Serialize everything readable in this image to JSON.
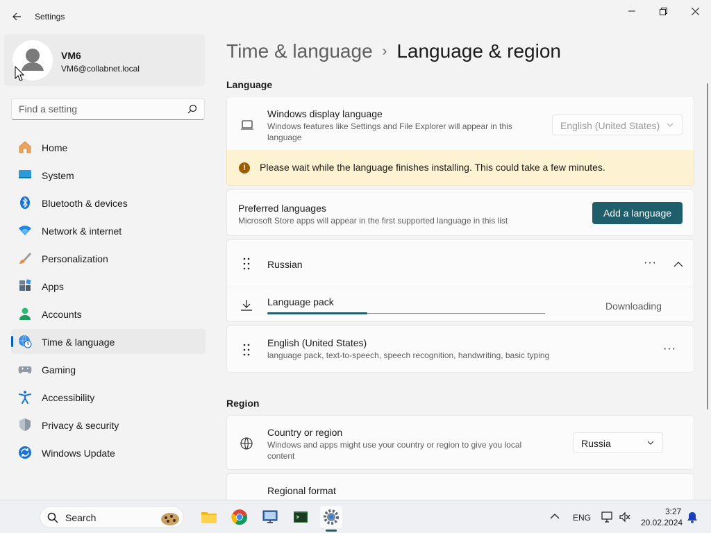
{
  "window": {
    "title": "Settings"
  },
  "profile": {
    "name": "VM6",
    "email": "VM6@collabnet.local"
  },
  "search": {
    "placeholder": "Find a setting"
  },
  "nav": {
    "items": [
      {
        "label": "Home",
        "icon": "home-icon"
      },
      {
        "label": "System",
        "icon": "system-icon"
      },
      {
        "label": "Bluetooth & devices",
        "icon": "bluetooth-icon"
      },
      {
        "label": "Network & internet",
        "icon": "wifi-icon"
      },
      {
        "label": "Personalization",
        "icon": "brush-icon"
      },
      {
        "label": "Apps",
        "icon": "apps-icon"
      },
      {
        "label": "Accounts",
        "icon": "accounts-icon"
      },
      {
        "label": "Time & language",
        "icon": "globe-clock-icon",
        "active": true
      },
      {
        "label": "Gaming",
        "icon": "gamepad-icon"
      },
      {
        "label": "Accessibility",
        "icon": "accessibility-icon"
      },
      {
        "label": "Privacy & security",
        "icon": "shield-icon"
      },
      {
        "label": "Windows Update",
        "icon": "update-icon"
      }
    ]
  },
  "breadcrumb": {
    "parent": "Time & language",
    "separator": "›",
    "current": "Language & region"
  },
  "language_section": {
    "heading": "Language",
    "display_language": {
      "title": "Windows display language",
      "description": "Windows features like Settings and File Explorer will appear in this language",
      "selected": "English (United States)"
    },
    "warning": "Please wait while the language finishes installing. This could take a few minutes.",
    "preferred": {
      "title": "Preferred languages",
      "description": "Microsoft Store apps will appear in the first supported language in this list",
      "add_button": "Add a language"
    },
    "languages": [
      {
        "name": "Russian",
        "expanded": true,
        "pack": {
          "label": "Language pack",
          "status": "Downloading",
          "progress": 0.36
        }
      },
      {
        "name": "English (United States)",
        "description": "language pack, text-to-speech, speech recognition, handwriting, basic typing"
      }
    ],
    "more_glyph": "···"
  },
  "region_section": {
    "heading": "Region",
    "country": {
      "title": "Country or region",
      "description": "Windows and apps might use your country or region to give you local content",
      "selected": "Russia"
    },
    "format": {
      "title": "Regional format"
    }
  },
  "taskbar": {
    "search_label": "Search",
    "apps": [
      "file-explorer-icon",
      "chrome-icon",
      "remote-desktop-icon",
      "terminal-icon",
      "settings-icon"
    ],
    "tray": {
      "language": "ENG",
      "time": "3:27",
      "date": "20.02.2024"
    }
  },
  "colors": {
    "accent": "#1f5e6b",
    "warning_bg": "#fdf3d3",
    "nav_active_marker": "#005fb8"
  }
}
